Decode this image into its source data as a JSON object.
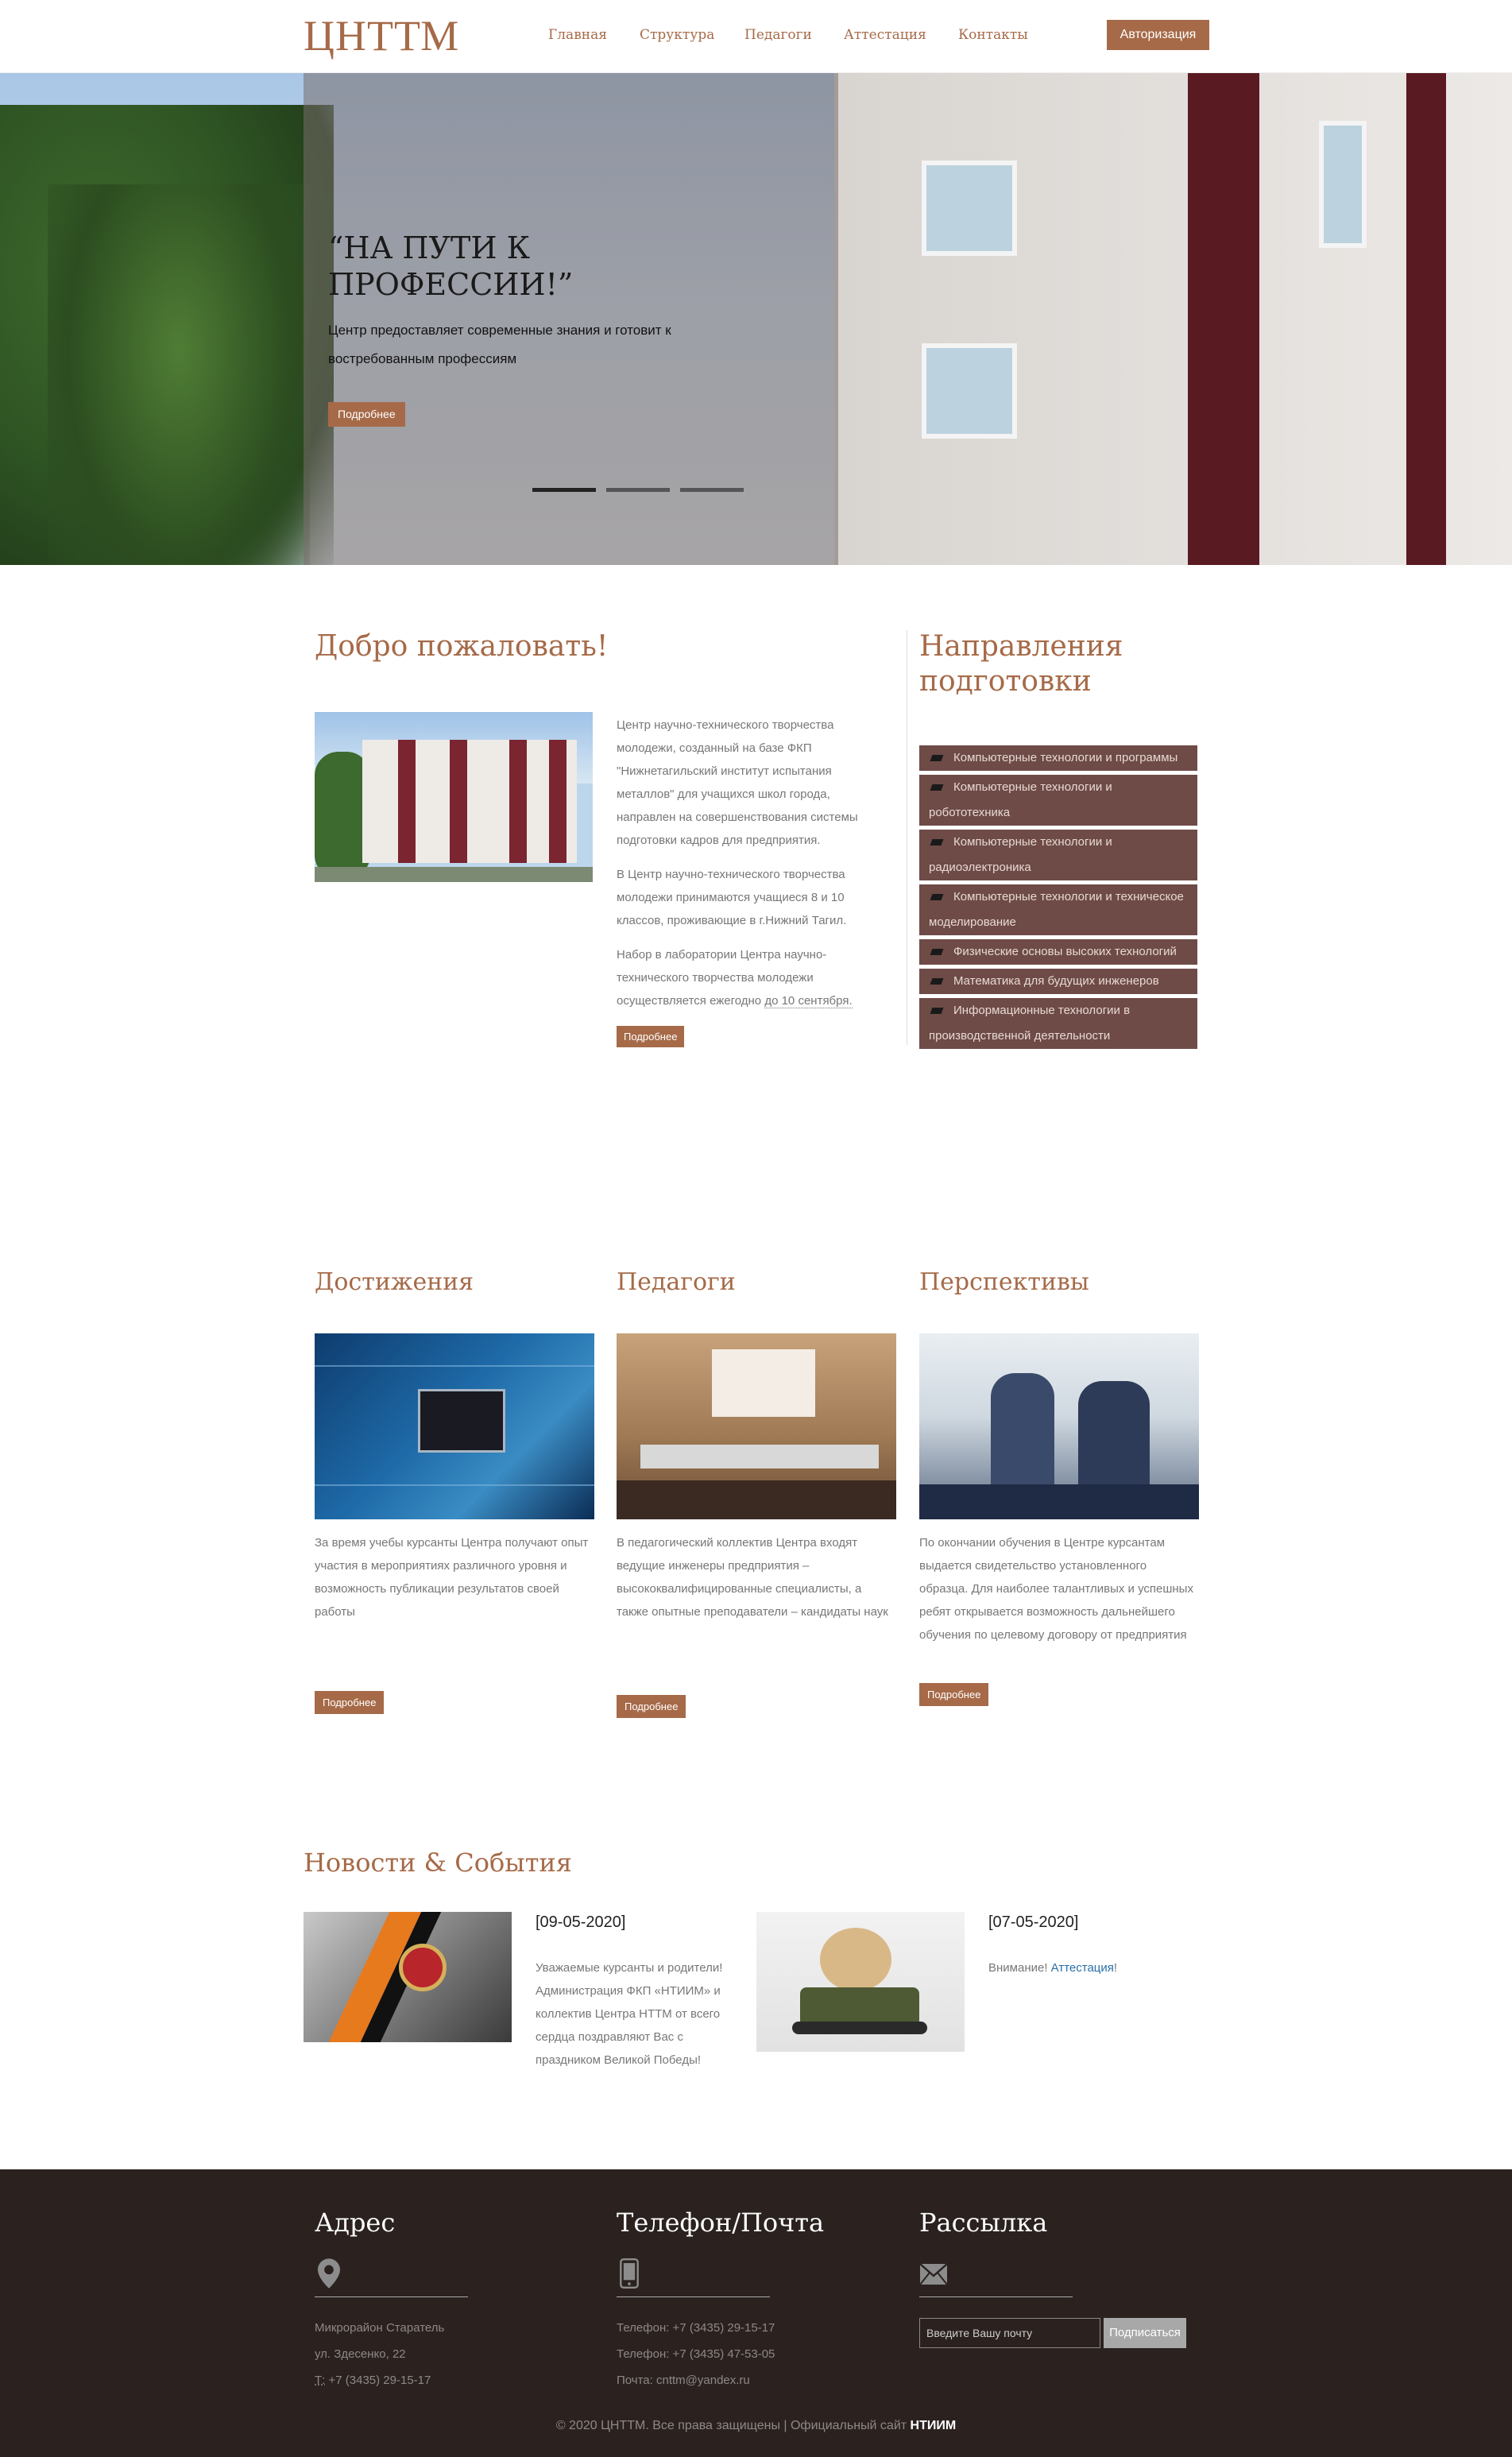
{
  "header": {
    "logo": "ЦНТТМ",
    "nav": [
      "Главная",
      "Структура",
      "Педагоги",
      "Аттестация",
      "Контакты"
    ],
    "auth_label": "Авторизация"
  },
  "hero": {
    "title": "“НА ПУТИ К ПРОФЕССИИ!”",
    "text": "Центр предоставляет современные знания и готовит к востребованным профессиям",
    "more": "Подробнее",
    "slides": 3,
    "active_slide": 1
  },
  "welcome": {
    "title": "Добро пожаловать!",
    "p1": "Центр научно-технического творчества молодежи, созданный на базе ФКП \"Нижнетагильский институт испытания металлов\" для учащихся школ города, направлен на совершенствования системы подготовки кадров для предприятия.",
    "p2": "В Центр научно-технического творчества молодежи принимаются учащиеся 8 и 10 классов, проживающие в г.Нижний Тагил.",
    "p3_start": "Набор в лаборатории Центра научно-технического творчества молодежи осуществляется ежегодно ",
    "p3_date": "до 10 сентября.",
    "more": "Подробнее"
  },
  "directions": {
    "title": "Направления подготовки",
    "items": [
      "Компьютерные технологии и программы",
      "Компьютерные технологии и робототехника",
      "Компьютерные технологии и радиоэлектроника",
      "Компьютерные технологии и техническое моделирование",
      "Физические основы высоких технологий",
      "Математика для будущих инженеров",
      "Информационные технологии в производственной деятельности"
    ]
  },
  "columns": [
    {
      "title": "Достижения",
      "text": "За время учебы курсанты Центра получают опыт участия в мероприятиях различного уровня и возможность публикации результатов своей работы",
      "more": "Подробнее"
    },
    {
      "title": "Педагоги",
      "text": "В педагогический коллектив Центра входят ведущие инженеры предприятия – высококвалифицированные специалисты, а также опытные преподаватели – кандидаты наук",
      "more": "Подробнее"
    },
    {
      "title": "Перспективы",
      "text": "По окончании обучения в Центре курсантам выдается свидетельство установленного образца. Для наиболее талантливых и успешных ребят открывается возможность дальнейшего обучения по целевому договору от предприятия",
      "more": "Подробнее"
    }
  ],
  "news": {
    "title": "Новости & События",
    "items": [
      {
        "date": "[09-05-2020]",
        "text": "Уважаемые курсанты и родители! Администрация ФКП «НТИИМ» и коллектив Центра НТТМ от всего сердца поздравляют Вас с праздником Великой Победы!"
      },
      {
        "date": "[07-05-2020]",
        "text_start": "Внимание! ",
        "link": "Аттестация",
        "text_end": "!"
      }
    ]
  },
  "footer": {
    "address_title": "Адрес",
    "address_lines": [
      "Микрорайон Старатель",
      "ул. Здесенко, 22",
      "Т: +7 (3435) 29-15-17"
    ],
    "address_phone_prefix": "Т:",
    "address_phone": " +7 (3435) 29-15-17",
    "phone_title": "Телефон/Почта",
    "phone_lines": [
      "Телефон: +7 (3435) 29-15-17",
      "Телефон: +7 (3435) 47-53-05",
      "Почта: cnttm@yandex.ru"
    ],
    "subscribe_title": "Рассылка",
    "subscribe_placeholder": "Введите Вашу почту",
    "subscribe_button": "Подписаться",
    "copyright_text": "© 2020 ЦНТТМ. Все права защищены | Официальный сайт ",
    "copyright_link": "НТИИМ"
  },
  "colors": {
    "accent": "#a66a48",
    "directions_bg": "#6e4b47",
    "footer_bg": "#2b2220"
  },
  "icons": [
    "map-pin-icon",
    "phone-icon",
    "envelope-icon",
    "arrow-bullet-icon"
  ]
}
